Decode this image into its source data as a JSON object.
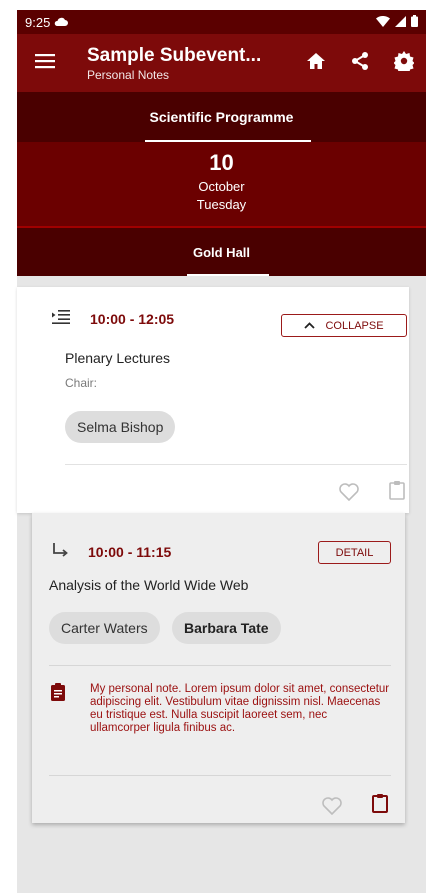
{
  "status": {
    "time": "9:25"
  },
  "appbar": {
    "title": "Sample Subevent...",
    "subtitle": "Personal Notes"
  },
  "tabs": {
    "programme": "Scientific Programme"
  },
  "date": {
    "day": "10",
    "month": "October",
    "weekday": "Tuesday"
  },
  "hall": {
    "name": "Gold Hall"
  },
  "session": {
    "time": "10:00 - 12:05",
    "collapse_label": "COLLAPSE",
    "title": "Plenary Lectures",
    "chair_label": "Chair:",
    "chair_chips": [
      "Selma Bishop"
    ]
  },
  "talk": {
    "time": "10:00 - 11:15",
    "detail_label": "DETAIL",
    "title": "Analysis of the World Wide Web",
    "speakers": [
      "Carter Waters",
      "Barbara Tate"
    ],
    "note": "My personal note. Lorem ipsum dolor sit amet, consectetur adipiscing elit. Vestibulum vitae dignissim nisl. Maecenas eu tristique est. Nulla suscipit laoreet sem, nec ullamcorper ligula finibus ac."
  },
  "colors": {
    "primary": "#7d0a0a",
    "dark": "#4a0000",
    "accent": "#9b1a1a"
  },
  "icons": [
    "cloud-icon",
    "wifi-icon",
    "signal-icon",
    "battery-icon",
    "menu-icon",
    "home-icon",
    "share-icon",
    "settings-icon",
    "indent-icon",
    "chevron-up-icon",
    "subdirectory-arrow-icon",
    "heart-icon",
    "clipboard-icon",
    "note-icon"
  ]
}
